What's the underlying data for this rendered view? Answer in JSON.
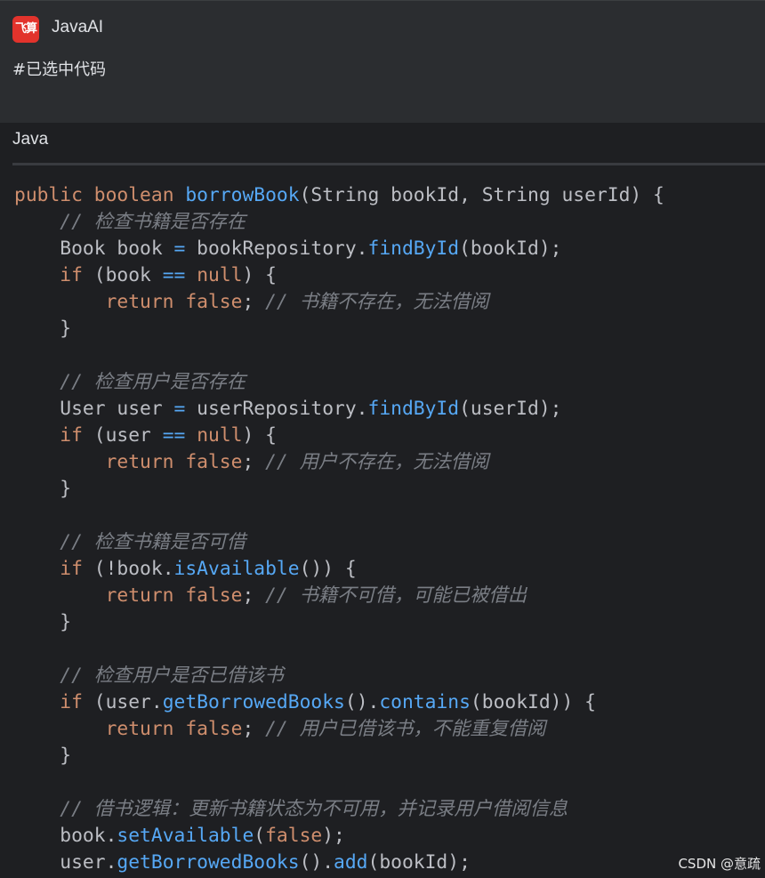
{
  "header": {
    "logo_text": "飞算",
    "app_name": "JavaAI",
    "selection_tag": "#已选中代码"
  },
  "code_block": {
    "language": "Java",
    "lines": [
      [
        {
          "t": "kw",
          "v": "public"
        },
        {
          "t": "p",
          "v": " "
        },
        {
          "t": "kw",
          "v": "boolean"
        },
        {
          "t": "p",
          "v": " "
        },
        {
          "t": "fn",
          "v": "borrowBook"
        },
        {
          "t": "p",
          "v": "(String bookId, String userId) {"
        }
      ],
      [
        {
          "t": "p",
          "v": "    "
        },
        {
          "t": "cm",
          "v": "// 检查书籍是否存在"
        }
      ],
      [
        {
          "t": "p",
          "v": "    Book book "
        },
        {
          "t": "fn",
          "v": "="
        },
        {
          "t": "p",
          "v": " bookRepository."
        },
        {
          "t": "fn",
          "v": "findById"
        },
        {
          "t": "p",
          "v": "(bookId);"
        }
      ],
      [
        {
          "t": "p",
          "v": "    "
        },
        {
          "t": "kw",
          "v": "if"
        },
        {
          "t": "p",
          "v": " (book "
        },
        {
          "t": "fn",
          "v": "=="
        },
        {
          "t": "p",
          "v": " "
        },
        {
          "t": "kw",
          "v": "null"
        },
        {
          "t": "p",
          "v": ") {"
        }
      ],
      [
        {
          "t": "p",
          "v": "        "
        },
        {
          "t": "kw",
          "v": "return"
        },
        {
          "t": "p",
          "v": " "
        },
        {
          "t": "kw",
          "v": "false"
        },
        {
          "t": "p",
          "v": "; "
        },
        {
          "t": "cm",
          "v": "// 书籍不存在，无法借阅"
        }
      ],
      [
        {
          "t": "p",
          "v": "    }"
        }
      ],
      [
        {
          "t": "p",
          "v": ""
        }
      ],
      [
        {
          "t": "p",
          "v": "    "
        },
        {
          "t": "cm",
          "v": "// 检查用户是否存在"
        }
      ],
      [
        {
          "t": "p",
          "v": "    User user "
        },
        {
          "t": "fn",
          "v": "="
        },
        {
          "t": "p",
          "v": " userRepository."
        },
        {
          "t": "fn",
          "v": "findById"
        },
        {
          "t": "p",
          "v": "(userId);"
        }
      ],
      [
        {
          "t": "p",
          "v": "    "
        },
        {
          "t": "kw",
          "v": "if"
        },
        {
          "t": "p",
          "v": " (user "
        },
        {
          "t": "fn",
          "v": "=="
        },
        {
          "t": "p",
          "v": " "
        },
        {
          "t": "kw",
          "v": "null"
        },
        {
          "t": "p",
          "v": ") {"
        }
      ],
      [
        {
          "t": "p",
          "v": "        "
        },
        {
          "t": "kw",
          "v": "return"
        },
        {
          "t": "p",
          "v": " "
        },
        {
          "t": "kw",
          "v": "false"
        },
        {
          "t": "p",
          "v": "; "
        },
        {
          "t": "cm",
          "v": "// 用户不存在，无法借阅"
        }
      ],
      [
        {
          "t": "p",
          "v": "    }"
        }
      ],
      [
        {
          "t": "p",
          "v": ""
        }
      ],
      [
        {
          "t": "p",
          "v": "    "
        },
        {
          "t": "cm",
          "v": "// 检查书籍是否可借"
        }
      ],
      [
        {
          "t": "p",
          "v": "    "
        },
        {
          "t": "kw",
          "v": "if"
        },
        {
          "t": "p",
          "v": " (!book."
        },
        {
          "t": "fn",
          "v": "isAvailable"
        },
        {
          "t": "p",
          "v": "()) {"
        }
      ],
      [
        {
          "t": "p",
          "v": "        "
        },
        {
          "t": "kw",
          "v": "return"
        },
        {
          "t": "p",
          "v": " "
        },
        {
          "t": "kw",
          "v": "false"
        },
        {
          "t": "p",
          "v": "; "
        },
        {
          "t": "cm",
          "v": "// 书籍不可借，可能已被借出"
        }
      ],
      [
        {
          "t": "p",
          "v": "    }"
        }
      ],
      [
        {
          "t": "p",
          "v": ""
        }
      ],
      [
        {
          "t": "p",
          "v": "    "
        },
        {
          "t": "cm",
          "v": "// 检查用户是否已借该书"
        }
      ],
      [
        {
          "t": "p",
          "v": "    "
        },
        {
          "t": "kw",
          "v": "if"
        },
        {
          "t": "p",
          "v": " (user."
        },
        {
          "t": "fn",
          "v": "getBorrowedBooks"
        },
        {
          "t": "p",
          "v": "()."
        },
        {
          "t": "fn",
          "v": "contains"
        },
        {
          "t": "p",
          "v": "(bookId)) {"
        }
      ],
      [
        {
          "t": "p",
          "v": "        "
        },
        {
          "t": "kw",
          "v": "return"
        },
        {
          "t": "p",
          "v": " "
        },
        {
          "t": "kw",
          "v": "false"
        },
        {
          "t": "p",
          "v": "; "
        },
        {
          "t": "cm",
          "v": "// 用户已借该书，不能重复借阅"
        }
      ],
      [
        {
          "t": "p",
          "v": "    }"
        }
      ],
      [
        {
          "t": "p",
          "v": ""
        }
      ],
      [
        {
          "t": "p",
          "v": "    "
        },
        {
          "t": "cm",
          "v": "// 借书逻辑：更新书籍状态为不可用，并记录用户借阅信息"
        }
      ],
      [
        {
          "t": "p",
          "v": "    book."
        },
        {
          "t": "fn",
          "v": "setAvailable"
        },
        {
          "t": "p",
          "v": "("
        },
        {
          "t": "kw",
          "v": "false"
        },
        {
          "t": "p",
          "v": ");"
        }
      ],
      [
        {
          "t": "p",
          "v": "    user."
        },
        {
          "t": "fn",
          "v": "getBorrowedBooks"
        },
        {
          "t": "p",
          "v": "()."
        },
        {
          "t": "fn",
          "v": "add"
        },
        {
          "t": "p",
          "v": "(bookId);"
        }
      ]
    ]
  },
  "watermark": "CSDN @意疏",
  "colors": {
    "keyword": "#cf8e6d",
    "function": "#56a8f5",
    "comment": "#7a7e85",
    "plain": "#bcbec4",
    "background": "#1e1f22",
    "header_background": "#2b2d30",
    "logo": "#e2332c"
  }
}
